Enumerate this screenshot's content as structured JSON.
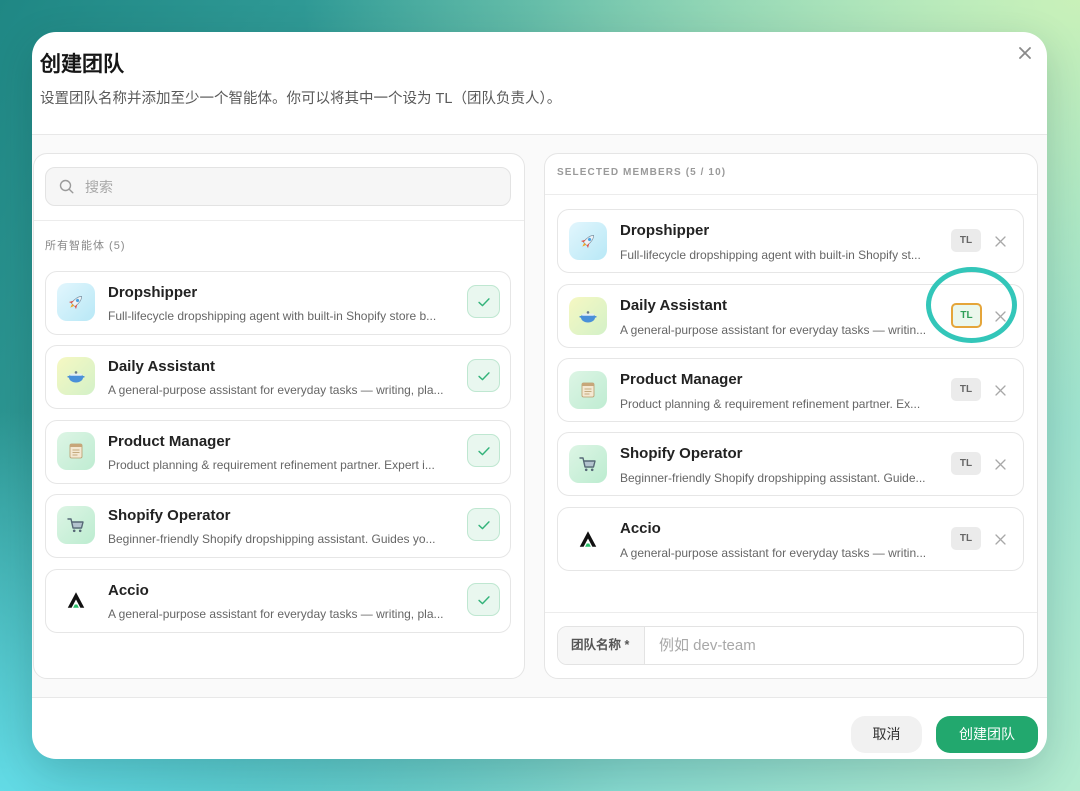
{
  "modal": {
    "title": "创建团队",
    "subtitle": "设置团队名称并添加至少一个智能体。你可以将其中一个设为 TL（团队负责人）。"
  },
  "search": {
    "placeholder": "搜索",
    "value": "",
    "icon": "search-icon"
  },
  "all_agents": {
    "label": "所有智能体 (5)",
    "items": [
      {
        "name": "Dropshipper",
        "desc": "Full-lifecycle dropshipping agent with built-in Shopify store b...",
        "icon": "rocket-icon",
        "selected": true
      },
      {
        "name": "Daily Assistant",
        "desc": "A general-purpose assistant for everyday tasks — writing, pla...",
        "icon": "pot-icon",
        "selected": true
      },
      {
        "name": "Product Manager",
        "desc": "Product planning & requirement refinement partner. Expert i...",
        "icon": "notepad-icon",
        "selected": true
      },
      {
        "name": "Shopify Operator",
        "desc": "Beginner-friendly Shopify dropshipping assistant. Guides yo...",
        "icon": "cart-icon",
        "selected": true
      },
      {
        "name": "Accio",
        "desc": "A general-purpose assistant for everyday tasks — writing, pla...",
        "icon": "accio-logo-icon",
        "selected": true
      }
    ]
  },
  "selected_members": {
    "label": "SELECTED MEMBERS (5 / 10)",
    "tl_label": "TL",
    "items": [
      {
        "name": "Dropshipper",
        "desc": "Full-lifecycle dropshipping agent with built-in Shopify st...",
        "icon": "rocket-icon",
        "is_tl": false
      },
      {
        "name": "Daily Assistant",
        "desc": "A general-purpose assistant for everyday tasks — writin...",
        "icon": "pot-icon",
        "is_tl": true
      },
      {
        "name": "Product Manager",
        "desc": "Product planning & requirement refinement partner. Ex...",
        "icon": "notepad-icon",
        "is_tl": false
      },
      {
        "name": "Shopify Operator",
        "desc": "Beginner-friendly Shopify dropshipping assistant. Guide...",
        "icon": "cart-icon",
        "is_tl": false
      },
      {
        "name": "Accio",
        "desc": "A general-purpose assistant for everyday tasks — writin...",
        "icon": "accio-logo-icon",
        "is_tl": false
      }
    ]
  },
  "team_name": {
    "label": "团队名称 *",
    "placeholder": "例如 dev-team",
    "value": ""
  },
  "footer": {
    "cancel_label": "取消",
    "create_label": "创建团队"
  },
  "colors": {
    "accent": "#22a86e",
    "check_green": "#33b37a",
    "highlight_ring": "#33c6b9",
    "tl_active_border": "#e5a53a",
    "tl_active_text": "#2f9e57"
  }
}
